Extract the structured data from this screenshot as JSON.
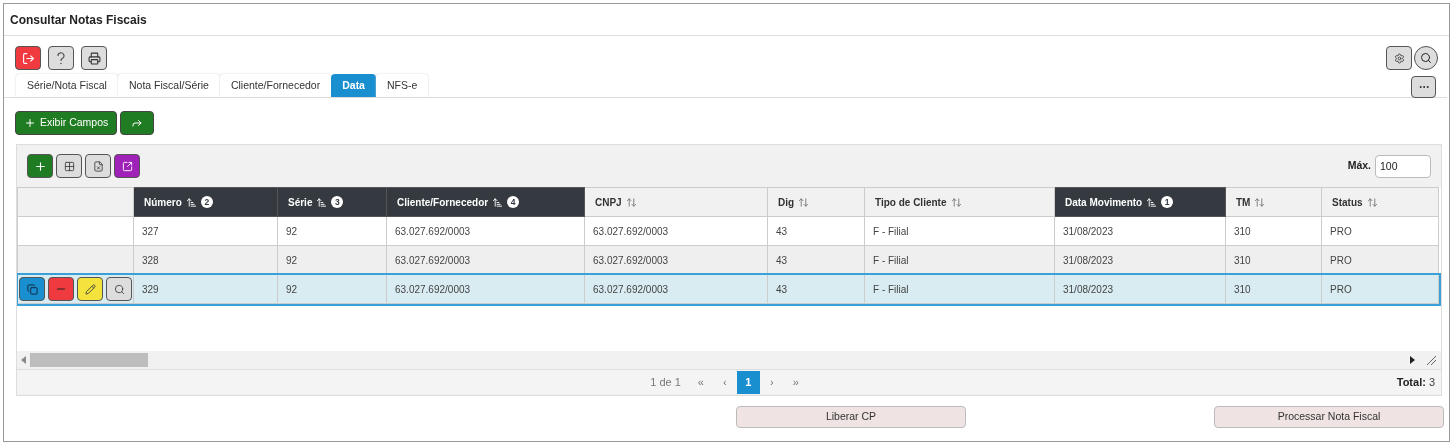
{
  "window": {
    "title": "Consultar Notas Fiscais"
  },
  "tabs": [
    {
      "label": "Série/Nota Fiscal",
      "selected": false
    },
    {
      "label": "Nota Fiscal/Série",
      "selected": false
    },
    {
      "label": "Cliente/Fornecedor",
      "selected": false
    },
    {
      "label": "Data",
      "selected": true
    },
    {
      "label": "NFS-e",
      "selected": false
    }
  ],
  "exibir_campos": "Exibir Campos",
  "max": {
    "label": "Máx.",
    "value": "100"
  },
  "table": {
    "columns": [
      {
        "label": "Número",
        "sorted": true,
        "sort_order": "2"
      },
      {
        "label": "Série",
        "sorted": true,
        "sort_order": "3"
      },
      {
        "label": "Cliente/Fornecedor",
        "sorted": true,
        "sort_order": "4"
      },
      {
        "label": "CNPJ",
        "sorted": false
      },
      {
        "label": "Dig",
        "sorted": false
      },
      {
        "label": "Tipo de Cliente",
        "sorted": false
      },
      {
        "label": "Data Movimento",
        "sorted": true,
        "sort_order": "1"
      },
      {
        "label": "TM",
        "sorted": false
      },
      {
        "label": "Status",
        "sorted": false
      }
    ],
    "rows": [
      {
        "selected": false,
        "cells": [
          "327",
          "92",
          "63.027.692/0003",
          "63.027.692/0003",
          "43",
          "F - Filial",
          "31/08/2023",
          "310",
          "PRO"
        ]
      },
      {
        "selected": false,
        "cells": [
          "328",
          "92",
          "63.027.692/0003",
          "63.027.692/0003",
          "43",
          "F - Filial",
          "31/08/2023",
          "310",
          "PRO"
        ]
      },
      {
        "selected": true,
        "cells": [
          "329",
          "92",
          "63.027.692/0003",
          "63.027.692/0003",
          "43",
          "F - Filial",
          "31/08/2023",
          "310",
          "PRO"
        ]
      }
    ]
  },
  "pagination": {
    "info": "1 de 1",
    "first": "«",
    "prev": "‹",
    "pages": [
      {
        "label": "1",
        "selected": true
      }
    ],
    "next": "›",
    "last": "»",
    "total_label": "Total:",
    "total": "3"
  },
  "buttons": [
    "Liberar CP",
    "Processar Nota Fiscal"
  ]
}
